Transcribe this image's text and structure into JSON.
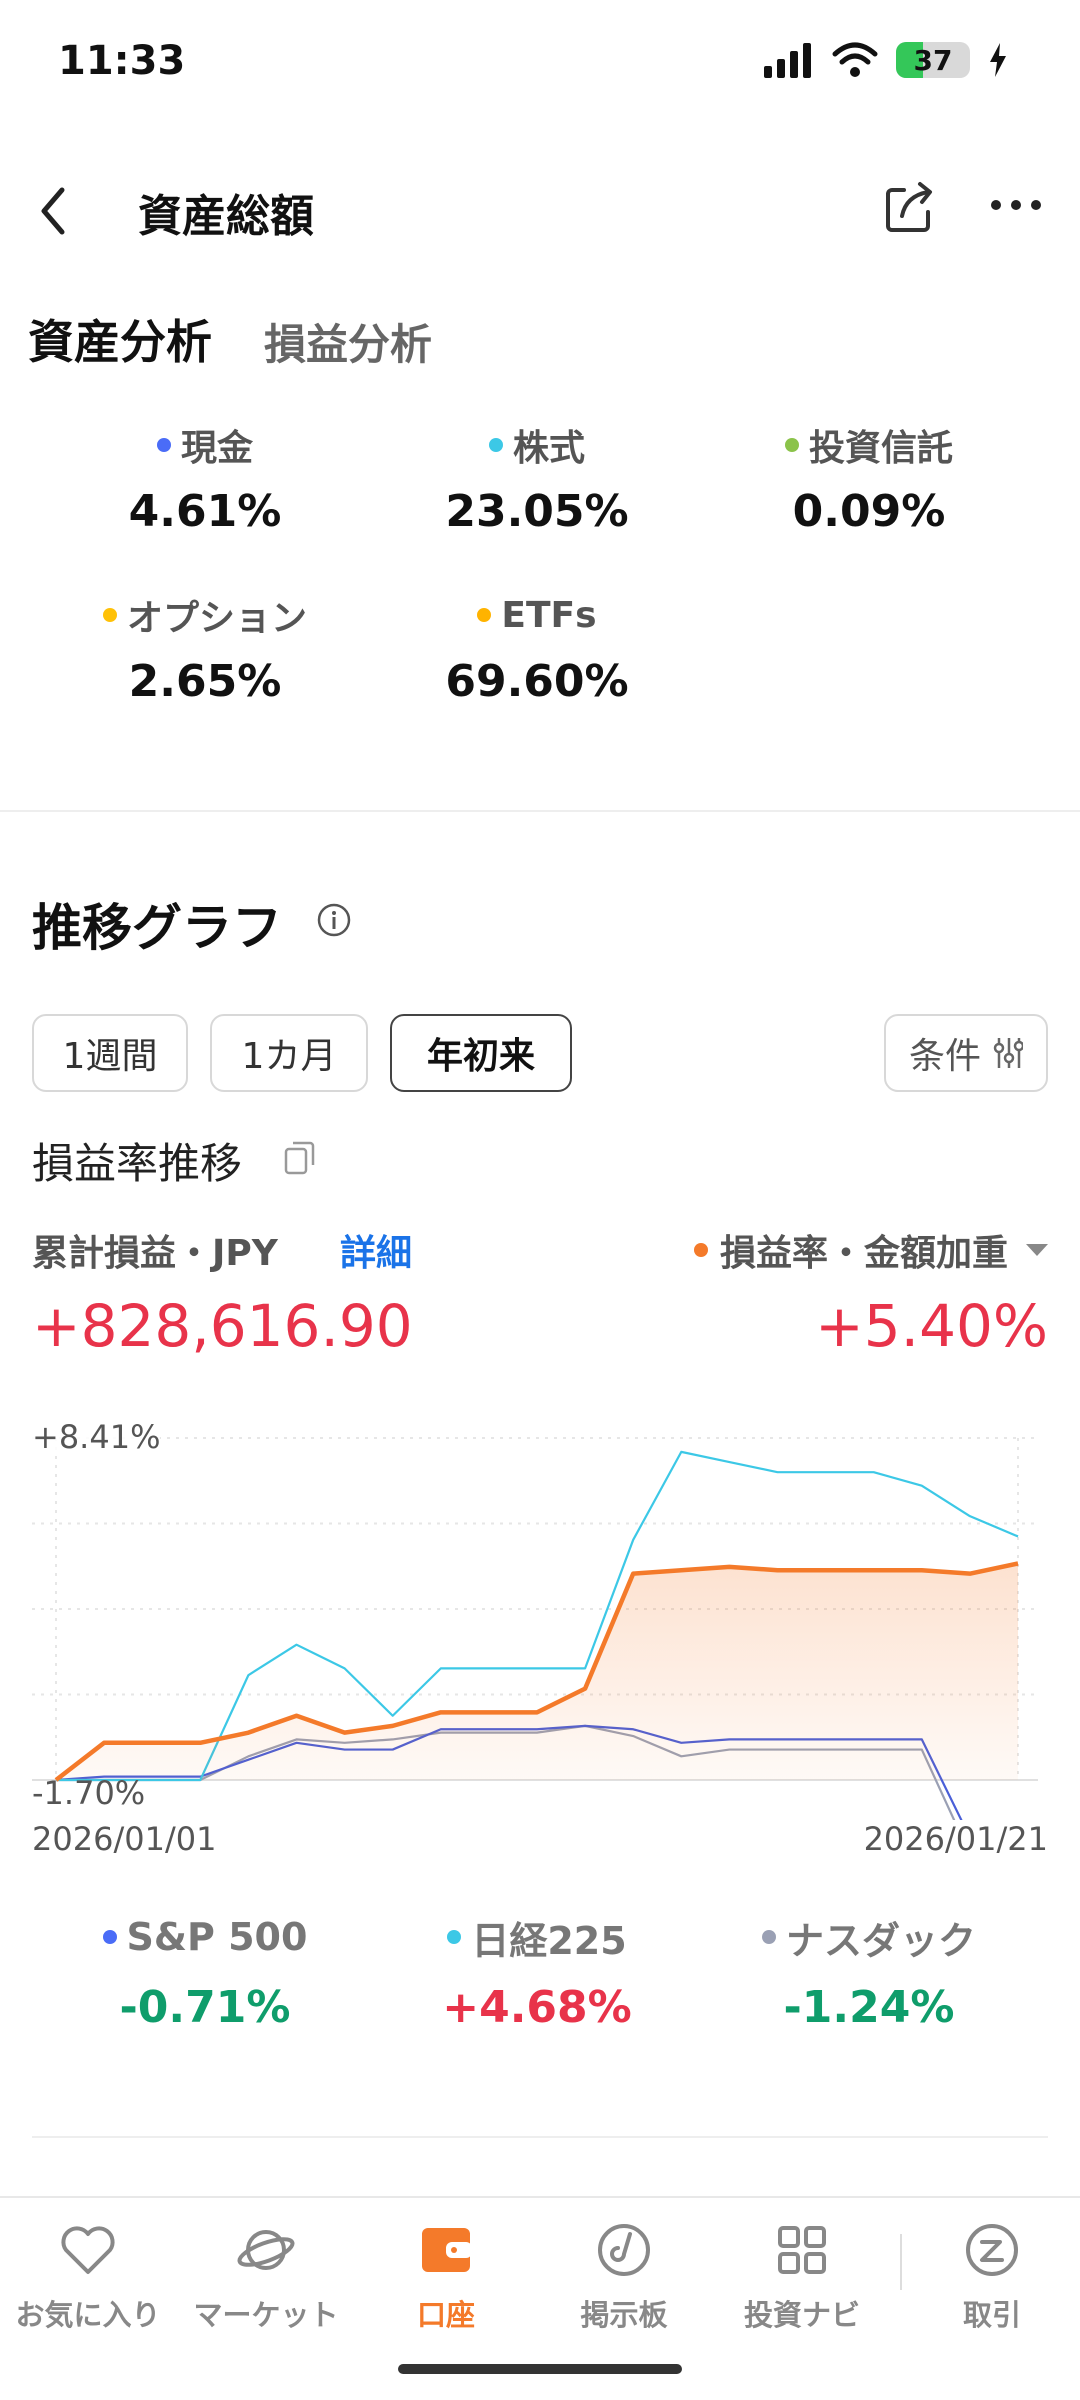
{
  "status": {
    "time": "11:33",
    "battery": "37",
    "battery_level": 0.37
  },
  "header": {
    "title": "資産総額"
  },
  "tabs": [
    {
      "label": "資産分析",
      "active": true
    },
    {
      "label": "損益分析",
      "active": false
    }
  ],
  "allocation": [
    {
      "label": "現金",
      "value": "4.61%",
      "color": "#4a6cf7"
    },
    {
      "label": "株式",
      "value": "23.05%",
      "color": "#3cc8e6"
    },
    {
      "label": "投資信託",
      "value": "0.09%",
      "color": "#8bc34a"
    },
    {
      "label": "オプション",
      "value": "2.65%",
      "color": "#ffc107"
    },
    {
      "label": "ETFs",
      "value": "69.60%",
      "color": "#ffb300"
    }
  ],
  "trend": {
    "title": "推移グラフ",
    "periods": [
      "1週間",
      "1カ月",
      "年初来"
    ],
    "active_period": "年初来",
    "condition_label": "条件",
    "subtitle": "損益率推移",
    "metric_label": "累計損益・JPY",
    "detail_link": "詳細",
    "rate_selector": "損益率・金額加重",
    "cumulative_pl": "+828,616.90",
    "pl_rate": "+5.40%"
  },
  "chart_data": {
    "type": "line",
    "y_max_label": "+8.41%",
    "y_min_label": "-1.70%",
    "ylim": [
      -1.7,
      8.41
    ],
    "x_start": "2026/01/01",
    "x_end": "2026/01/21",
    "grid": true,
    "series": [
      {
        "name": "損益率・金額加重",
        "color": "#f47a2a",
        "fill": true,
        "values": [
          -1.7,
          -0.6,
          -0.6,
          -0.6,
          -0.3,
          0.2,
          -0.3,
          -0.1,
          0.3,
          0.3,
          0.3,
          1.0,
          4.4,
          4.5,
          4.6,
          4.5,
          4.5,
          4.5,
          4.5,
          4.4,
          4.7
        ]
      },
      {
        "name": "S&P 500",
        "color": "#4a5fd8",
        "values": [
          -1.7,
          -1.6,
          -1.6,
          -1.6,
          -1.1,
          -0.6,
          -0.8,
          -0.8,
          -0.2,
          -0.2,
          -0.2,
          -0.1,
          -0.2,
          -0.6,
          -0.5,
          -0.5,
          -0.5,
          -0.5,
          -0.5,
          -3.4,
          -3.4
        ]
      },
      {
        "name": "日経225",
        "color": "#3cc8e6",
        "values": [
          -1.7,
          -1.7,
          -1.7,
          -1.7,
          1.4,
          2.3,
          1.6,
          0.2,
          1.6,
          1.6,
          1.6,
          1.6,
          5.4,
          8.0,
          7.7,
          7.4,
          7.4,
          7.4,
          7.0,
          6.1,
          5.5
        ]
      },
      {
        "name": "ナスダック",
        "color": "#9aa0b4",
        "values": [
          -1.7,
          -1.7,
          -1.7,
          -1.7,
          -1.0,
          -0.5,
          -0.6,
          -0.5,
          -0.3,
          -0.3,
          -0.3,
          -0.1,
          -0.4,
          -1.0,
          -0.8,
          -0.8,
          -0.8,
          -0.8,
          -0.8,
          -3.9,
          -3.9
        ]
      }
    ]
  },
  "benchmarks": [
    {
      "label": "S&P 500",
      "value": "-0.71%",
      "color": "#4a6cf7",
      "positive": false
    },
    {
      "label": "日経225",
      "value": "+4.68%",
      "color": "#3cc8e6",
      "positive": true
    },
    {
      "label": "ナスダック",
      "value": "-1.24%",
      "color": "#9aa0b4",
      "positive": false
    }
  ],
  "tabbar": [
    {
      "label": "お気に入り",
      "icon": "heart-icon"
    },
    {
      "label": "マーケット",
      "icon": "planet-icon"
    },
    {
      "label": "口座",
      "icon": "wallet-icon",
      "active": true
    },
    {
      "label": "掲示板",
      "icon": "board-icon"
    },
    {
      "label": "投資ナビ",
      "icon": "grid-icon"
    },
    {
      "label": "取引",
      "icon": "trade-icon"
    }
  ]
}
